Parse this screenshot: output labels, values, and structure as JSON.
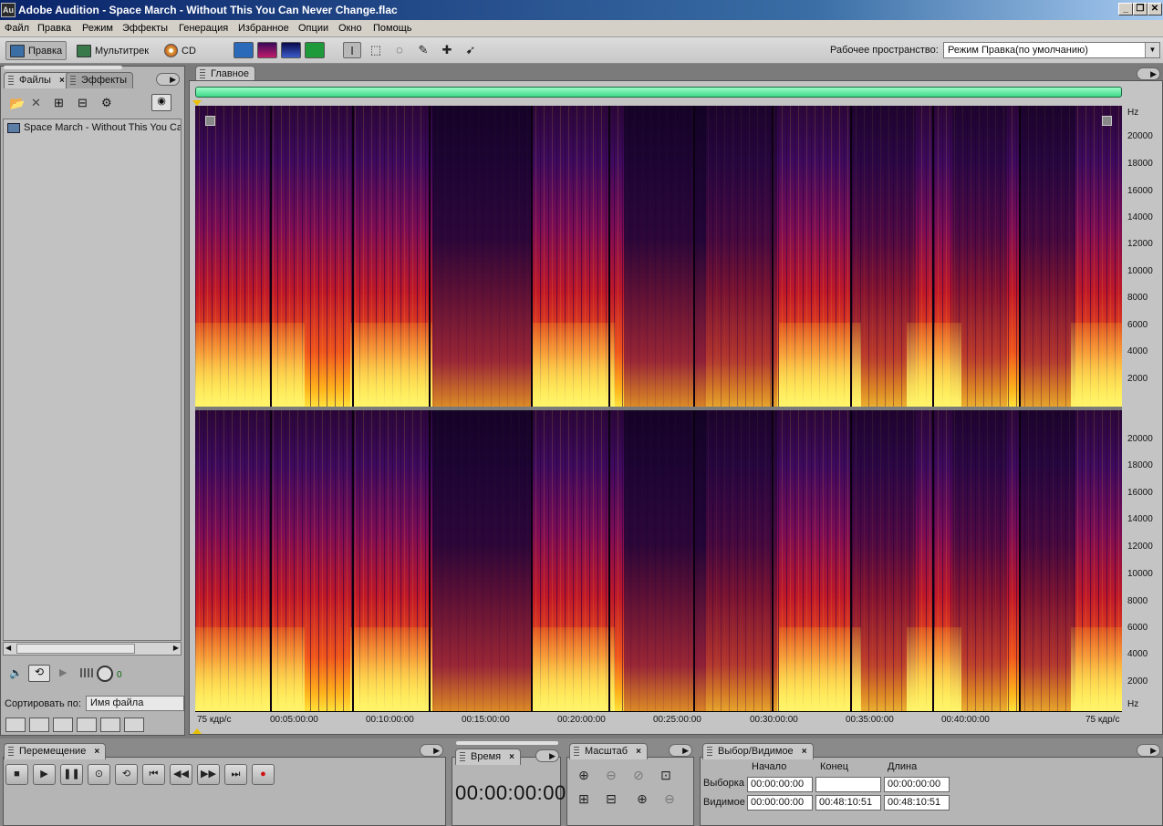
{
  "window": {
    "app_icon": "Au",
    "title": "Adobe Audition - Space March - Without This You Can Never Change.flac",
    "min_label": "_",
    "max_label": "❐",
    "close_label": "✕"
  },
  "menu": [
    "Файл",
    "Правка",
    "Режим",
    "Эффекты",
    "Генерация",
    "Избранное",
    "Опции",
    "Окно",
    "Помощь"
  ],
  "toolbar": {
    "edit_label": "Правка",
    "multitrack_label": "Мультитрек",
    "cd_label": "CD",
    "workspace_label": "Рабочее пространство:",
    "workspace_value": "Режим Правка(по умолчанию)",
    "view_colors": [
      "#2a6ab8",
      "#8a1a6a",
      "#1a3a9a",
      "#1f9a3a"
    ]
  },
  "files_panel": {
    "tab_files": "Файлы",
    "tab_effects": "Эффекты",
    "file_name": "Space March - Without This You Can Never Change.flac",
    "sort_label": "Сортировать по:",
    "sort_value": "Имя файла",
    "volume_value": "0"
  },
  "editor": {
    "tab": "Главное",
    "y_unit": "Hz",
    "y_ticks_top": [
      "20000",
      "18000",
      "16000",
      "14000",
      "12000",
      "10000",
      "8000",
      "6000",
      "4000",
      "2000"
    ],
    "y_ticks_bottom": [
      "20000",
      "18000",
      "16000",
      "14000",
      "12000",
      "10000",
      "8000",
      "6000",
      "4000",
      "2000"
    ],
    "y_unit_bottom": "Hz",
    "x_left": "75 кдр/с",
    "x_right": "75 кдр/с",
    "x_ticks": [
      "00:05:00:00",
      "00:10:00:00",
      "00:15:00:00",
      "00:20:00:00",
      "00:25:00:00",
      "00:30:00:00",
      "00:35:00:00",
      "00:40:00:00"
    ]
  },
  "transport": {
    "tab": "Перемещение"
  },
  "time_panel": {
    "tab": "Время",
    "value": "00:00:00:00"
  },
  "zoom_panel": {
    "tab": "Масштаб"
  },
  "selection_panel": {
    "tab": "Выбор/Видимое",
    "col_start": "Начало",
    "col_end": "Конец",
    "col_length": "Длина",
    "row_selection": "Выборка",
    "row_visible": "Видимое",
    "sel_start": "00:00:00:00",
    "sel_end": "",
    "sel_length": "00:00:00:00",
    "vis_start": "00:00:00:00",
    "vis_end": "00:48:10:51",
    "vis_length": "00:48:10:51"
  }
}
